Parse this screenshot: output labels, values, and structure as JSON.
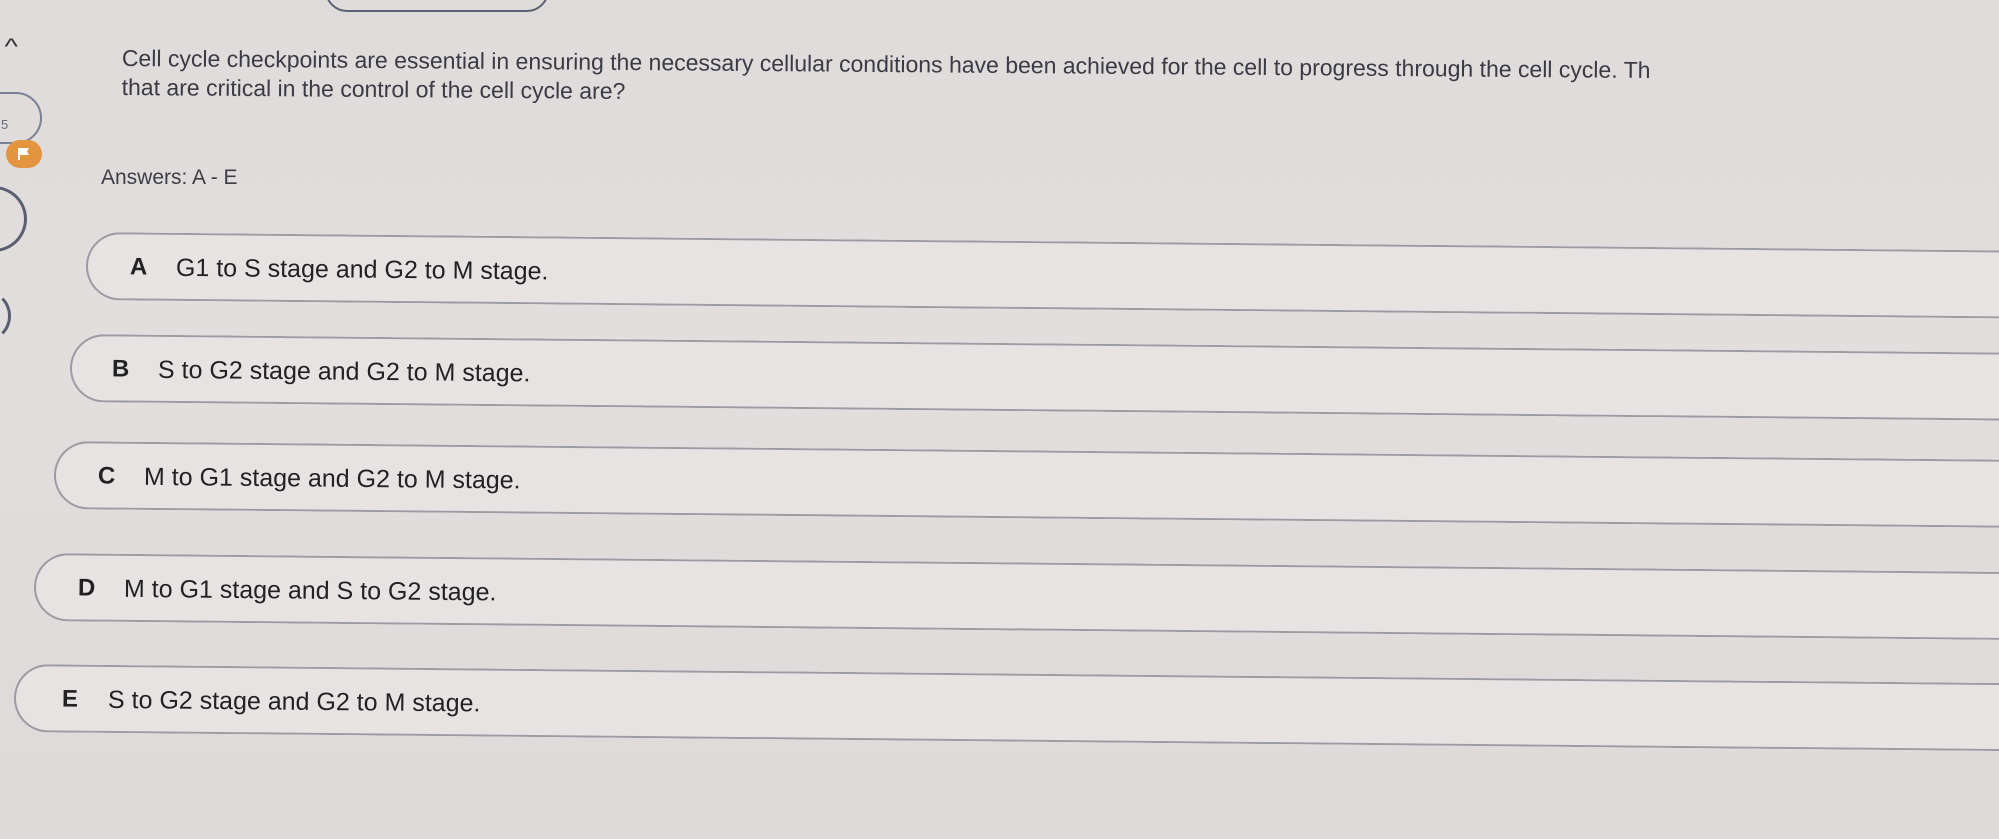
{
  "header": {
    "collapse_icon": "chevron-up-icon"
  },
  "question_nav": {
    "number": "5",
    "flag_icon": "flag-icon",
    "flag_color": "#e3943f"
  },
  "question": {
    "text": "Cell cycle checkpoints are essential in ensuring the necessary cellular conditions have been achieved for the cell to progress through the cell cycle. Th\nthat are critical in the control of the cell cycle are?"
  },
  "answers_label": "Answers: A - E",
  "options": [
    {
      "letter": "A",
      "text": "G1 to S stage and G2 to M stage."
    },
    {
      "letter": "B",
      "text": "S to G2 stage and G2 to M stage."
    },
    {
      "letter": "C",
      "text": "M to G1 stage and G2 to M stage."
    },
    {
      "letter": "D",
      "text": "M to G1 stage and S to G2 stage."
    },
    {
      "letter": "E",
      "text": "S to G2 stage and G2 to M stage."
    }
  ]
}
